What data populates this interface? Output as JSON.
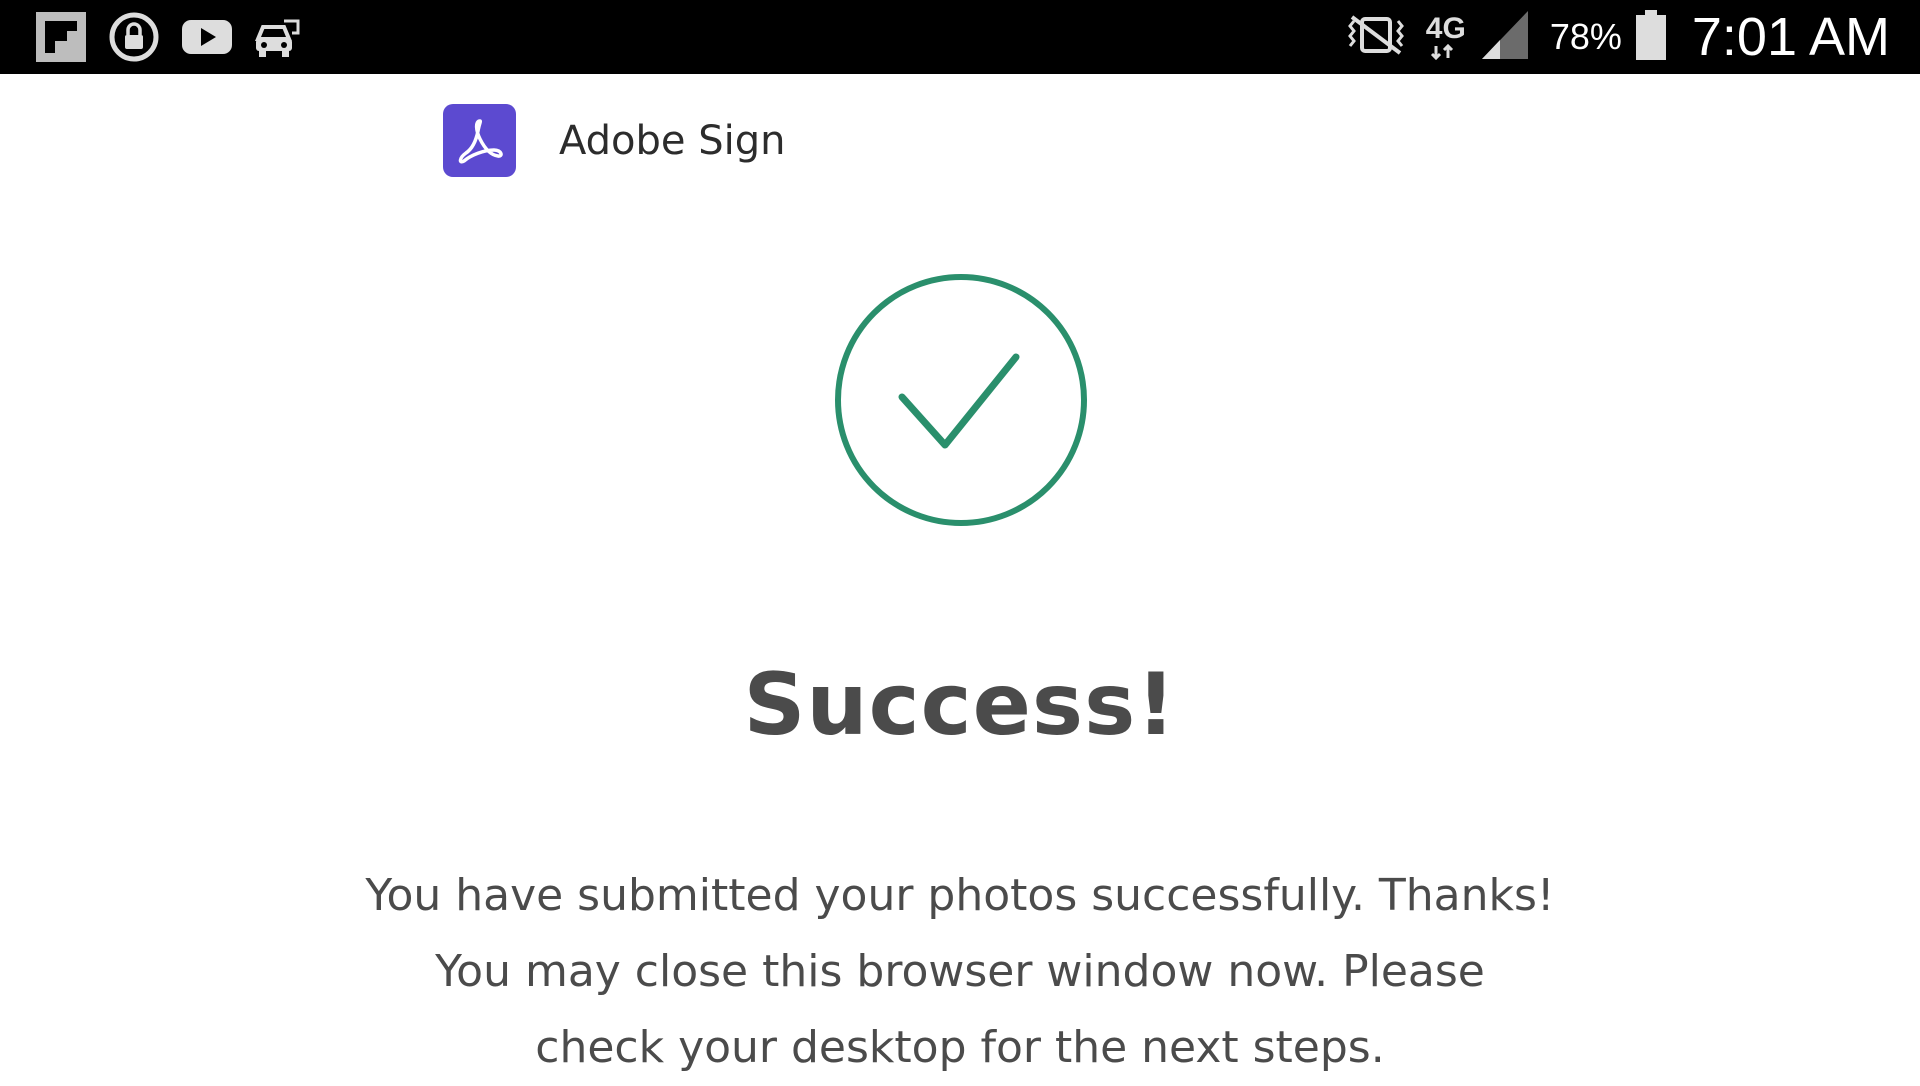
{
  "status_bar": {
    "icons_left": [
      "flipboard-icon",
      "lock-icon",
      "youtube-icon",
      "car-mode-icon"
    ],
    "icons_right": [
      "vibrate-icon",
      "network-4g-lte-icon",
      "signal-icon"
    ],
    "network_label": "4G",
    "battery_percent": "78%",
    "time": "7:01 AM"
  },
  "header": {
    "app_name": "Adobe Sign",
    "logo_color": "#5c4ad0"
  },
  "main": {
    "success_icon": "checkmark-circle-icon",
    "accent_color": "#2a8f6c",
    "title": "Success!",
    "message_lines": [
      "You have submitted your photos successfully. Thanks!",
      "You may close this browser window now. Please",
      "check your desktop for the next steps."
    ]
  }
}
